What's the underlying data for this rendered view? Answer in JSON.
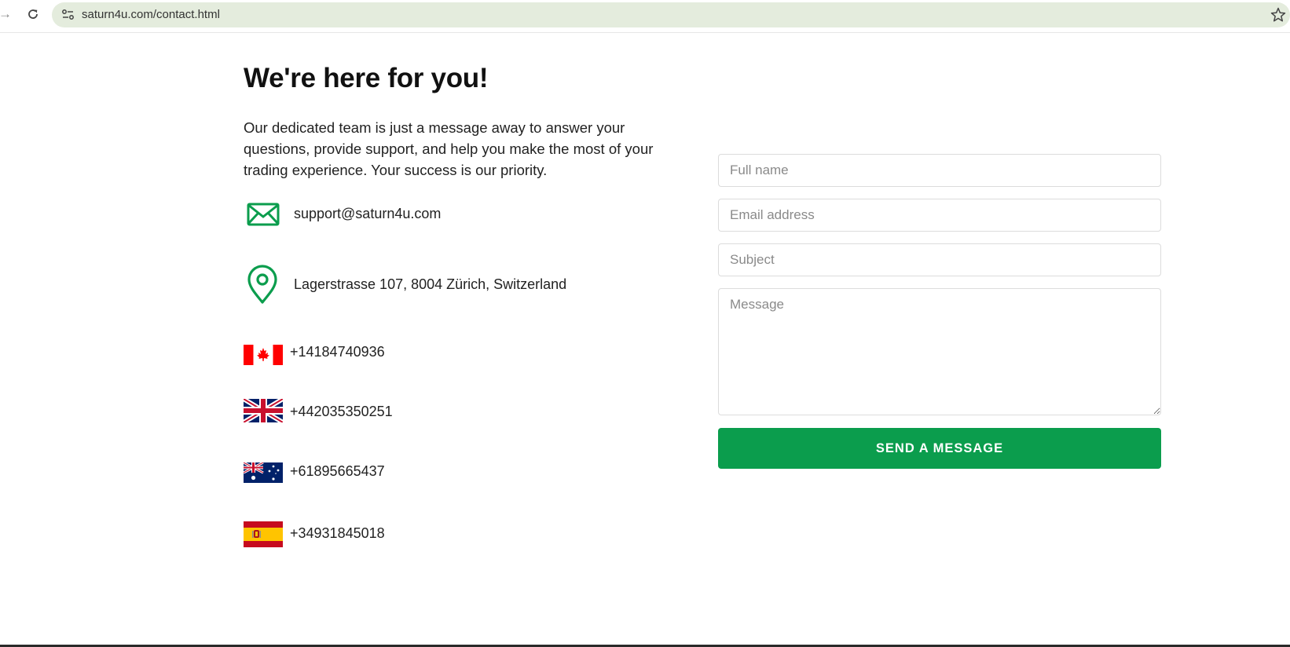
{
  "browser": {
    "url": "saturn4u.com/contact.html"
  },
  "contact": {
    "title": "We're here for you!",
    "intro": "Our dedicated team is just a message away to answer your questions, provide support, and help you make the most of your trading experience. Your success is our priority.",
    "email": "support@saturn4u.com",
    "address": "Lagerstrasse 107, 8004 Zürich, Switzerland",
    "phones": [
      {
        "country": "canada",
        "number": "+14184740936"
      },
      {
        "country": "united-kingdom",
        "number": "+442035350251"
      },
      {
        "country": "australia",
        "number": "+61895665437"
      },
      {
        "country": "spain",
        "number": "+34931845018"
      }
    ]
  },
  "form": {
    "full_name_placeholder": "Full name",
    "email_placeholder": "Email address",
    "subject_placeholder": "Subject",
    "message_placeholder": "Message",
    "submit_label": "SEND A MESSAGE"
  },
  "colors": {
    "accent": "#0b9d4d",
    "omnibox": "#e4ecdd"
  },
  "icons": [
    "arrow-forward-icon",
    "reload-icon",
    "site-info-icon",
    "bookmark-star-icon",
    "mail-icon",
    "location-pin-icon",
    "canada-flag-icon",
    "uk-flag-icon",
    "australia-flag-icon",
    "spain-flag-icon"
  ]
}
